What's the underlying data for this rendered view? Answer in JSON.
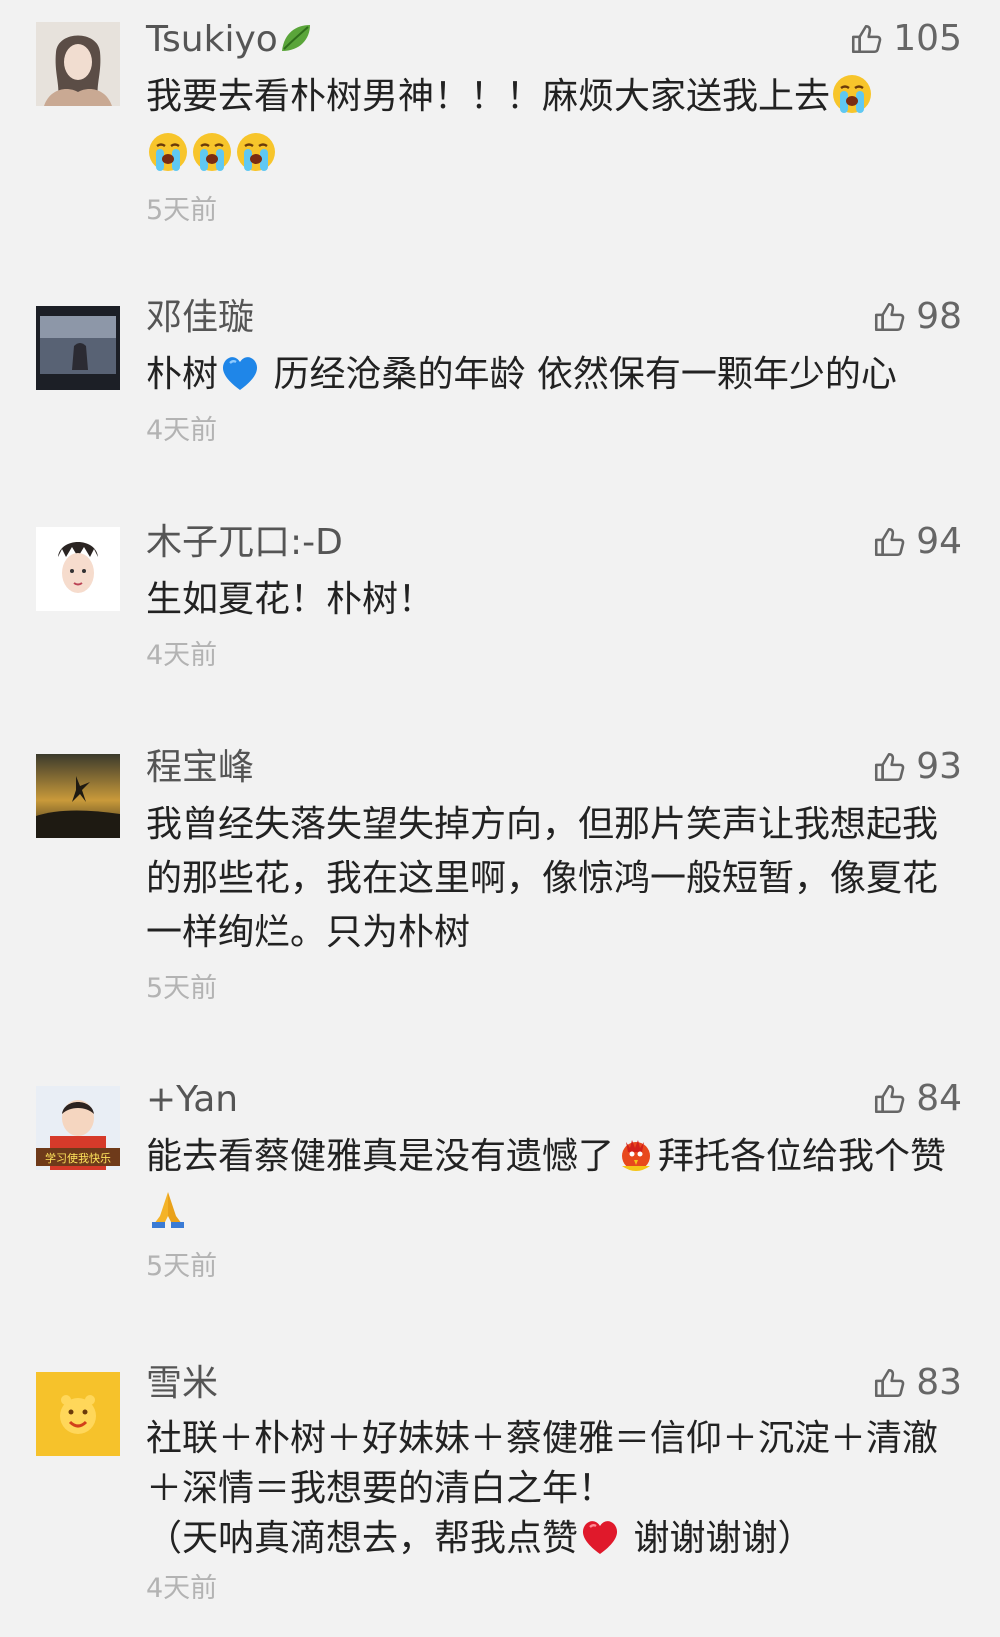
{
  "comments": [
    {
      "name": "Tsukiyo",
      "likes": "105",
      "text_parts": [
        "我要去看朴树男神！！！麻烦大家送我上去"
      ],
      "time": "5天前"
    },
    {
      "name": "邓佳璇",
      "likes": "98",
      "text_a": "朴树",
      "text_b": " 历经沧桑的年龄 依然保有一颗年少的心",
      "time": "4天前"
    },
    {
      "name": "木子兀口:-D",
      "likes": "94",
      "text": "生如夏花！朴树！",
      "time": "4天前"
    },
    {
      "name": "程宝峰",
      "likes": "93",
      "text": "我曾经失落失望失掉方向，但那片笑声让我想起我的那些花，我在这里啊，像惊鸿一般短暂，像夏花一样绚烂。只为朴树",
      "time": "5天前"
    },
    {
      "name": "+Yan",
      "likes": "84",
      "text_a": "能去看蔡健雅真是没有遗憾了",
      "text_b": "拜托各位给我个赞",
      "time": "5天前",
      "avatar_caption": "学习使我快乐"
    },
    {
      "name": "雪米",
      "likes": "83",
      "text_a": "社联＋朴树＋好妹妹＋蔡健雅＝信仰＋沉淀＋清澈＋深情＝我想要的清白之年！",
      "text_b": "（天呐真滴想去，帮我点赞",
      "text_c": " 谢谢谢谢）",
      "time": "4天前"
    }
  ],
  "colors": {
    "background": "#f2f2f2",
    "name": "#555555",
    "time": "#b3b3b3"
  },
  "icons": [
    "thumbs-up-icon",
    "crying-face-emoji",
    "blue-heart-emoji",
    "praying-hands-emoji",
    "red-heart-emoji",
    "leaf-emoji",
    "rooster-emoji"
  ]
}
